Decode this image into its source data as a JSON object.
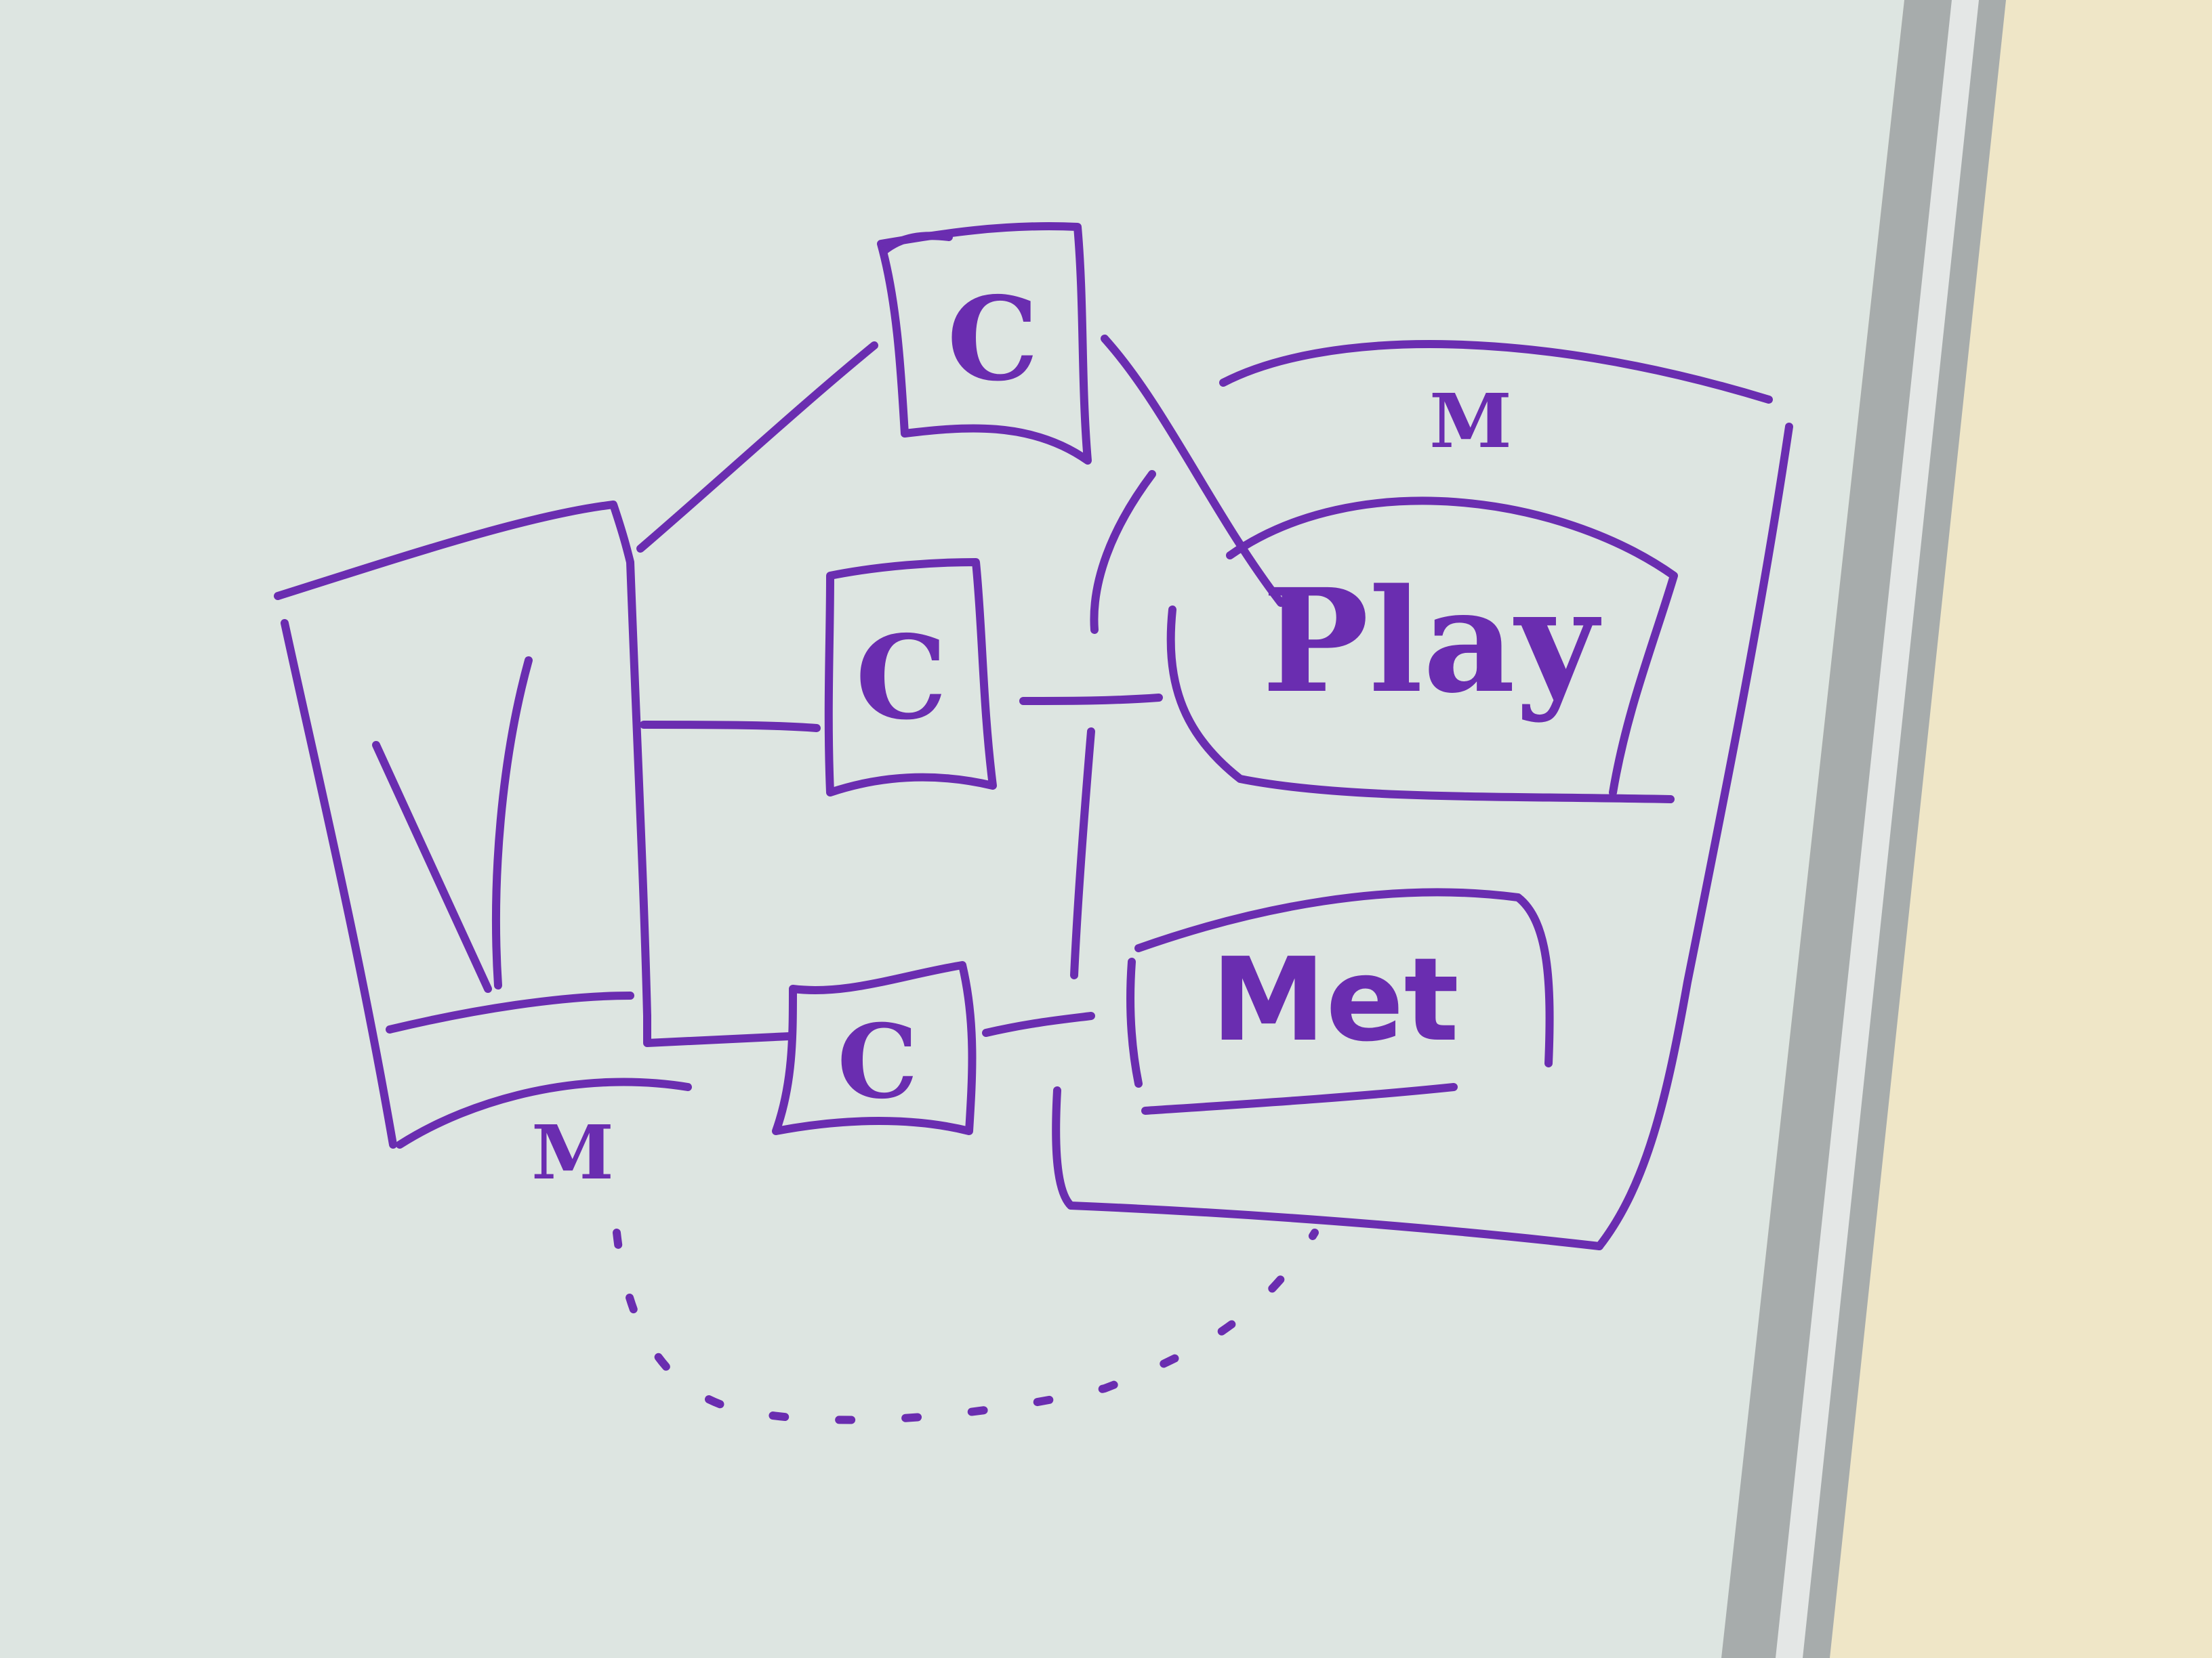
{
  "colors": {
    "board": "#dde5e1",
    "board_shadow": "#c9d3cf",
    "frame": "#a7acac",
    "frame_highlight": "#e4e7e6",
    "wall": "#efe6c7",
    "ink": "#6a2db0"
  },
  "diagram": {
    "view_label": "V",
    "controller_labels": [
      "C",
      "C",
      "C"
    ],
    "model_group_label": "M",
    "play_label": "Play",
    "met_label": "Met",
    "view_sub_label": "M"
  }
}
